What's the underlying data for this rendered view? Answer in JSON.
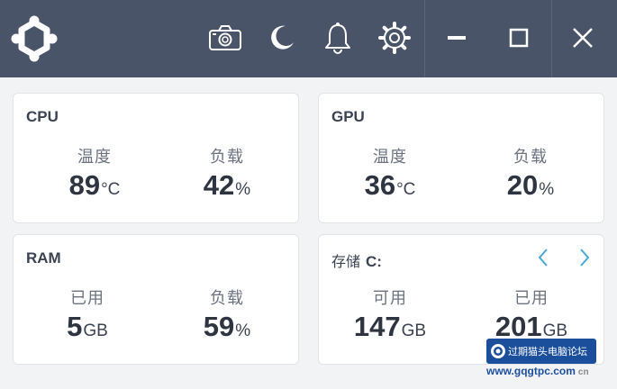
{
  "titlebar": {
    "icons": [
      "screenshot-icon",
      "dark-mode-icon",
      "notification-icon",
      "settings-icon",
      "minimize-icon",
      "maximize-icon",
      "close-icon"
    ]
  },
  "cpu": {
    "title": "CPU",
    "temp_label": "温度",
    "temp_value": "89",
    "temp_unit": "°C",
    "load_label": "负载",
    "load_value": "42",
    "load_unit": "%"
  },
  "gpu": {
    "title": "GPU",
    "temp_label": "温度",
    "temp_value": "36",
    "temp_unit": "°C",
    "load_label": "负载",
    "load_value": "20",
    "load_unit": "%"
  },
  "ram": {
    "title": "RAM",
    "used_label": "已用",
    "used_value": "5",
    "used_unit": "GB",
    "load_label": "负载",
    "load_value": "59",
    "load_unit": "%"
  },
  "storage": {
    "title": "存储",
    "drive": "C:",
    "free_label": "可用",
    "free_value": "147",
    "free_unit": "GB",
    "used_label": "已用",
    "used_value": "201",
    "used_unit": "GB"
  },
  "watermark": {
    "text": "过期猫头电脑论坛",
    "url": "www.gqgtpc.com",
    "suffix": "cn"
  },
  "colors": {
    "titlebar": "#4a5468",
    "accent": "#4aa8d8",
    "watermark": "#1b4f9c"
  }
}
